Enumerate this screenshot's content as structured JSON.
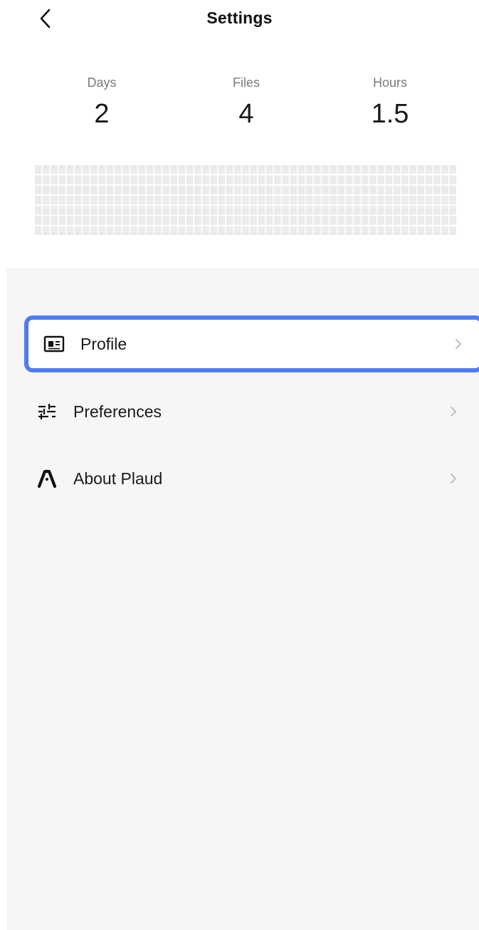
{
  "header": {
    "title": "Settings",
    "back_icon": "chevron-left-icon"
  },
  "stats": [
    {
      "label": "Days",
      "value": "2"
    },
    {
      "label": "Files",
      "value": "4"
    },
    {
      "label": "Hours",
      "value": "1.5"
    }
  ],
  "activity_grid": {
    "empty_color": "#ebebeb"
  },
  "menu": {
    "items": [
      {
        "label": "Profile",
        "icon": "id-card-icon",
        "selected": true
      },
      {
        "label": "Preferences",
        "icon": "sliders-icon",
        "selected": false
      },
      {
        "label": "About Plaud",
        "icon": "plaud-logo-icon",
        "selected": false
      }
    ]
  },
  "colors": {
    "selection_border": "#4f7cf3",
    "menu_background": "#f6f6f6",
    "chevron": "#b8b8b8"
  }
}
